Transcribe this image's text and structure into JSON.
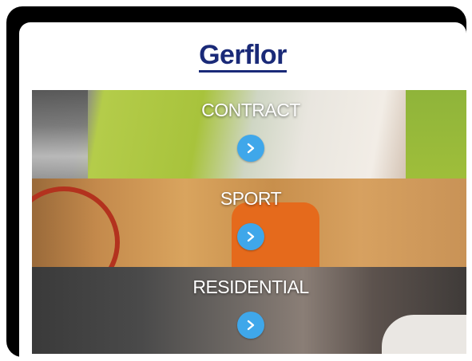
{
  "brand": {
    "logo_text": "Gerflor",
    "logo_color": "#1a2a78"
  },
  "categories": [
    {
      "label": "CONTRACT",
      "icon": "chevron-right-icon"
    },
    {
      "label": "SPORT",
      "icon": "chevron-right-icon"
    },
    {
      "label": "RESIDENTIAL",
      "icon": "chevron-right-icon"
    }
  ],
  "colors": {
    "button_accent": "#3fa7ea",
    "label_text": "#ffffff"
  }
}
